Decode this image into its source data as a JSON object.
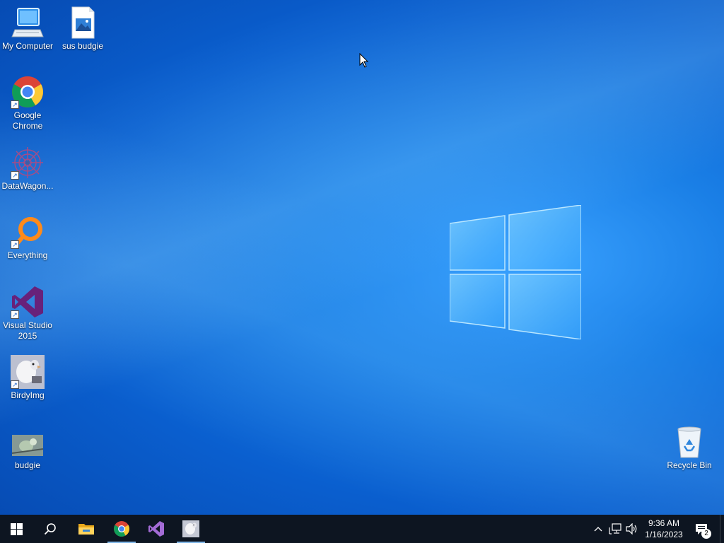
{
  "desktop": {
    "icons": [
      {
        "label": "My Computer",
        "icon": "computer-icon"
      },
      {
        "label": "sus budgie",
        "icon": "image-file-icon"
      },
      {
        "label": "Google Chrome",
        "icon": "chrome-icon"
      },
      {
        "label": "DataWagon...",
        "icon": "datawagon-icon"
      },
      {
        "label": "Everything",
        "icon": "everything-search-icon"
      },
      {
        "label": "Visual Studio 2015",
        "icon": "visual-studio-icon"
      },
      {
        "label": "BirdyImg",
        "icon": "bird-image-icon"
      },
      {
        "label": "budgie",
        "icon": "budgie-photo-icon"
      },
      {
        "label": "Recycle Bin",
        "icon": "recycle-bin-icon"
      }
    ]
  },
  "taskbar": {
    "buttons": [
      {
        "name": "start",
        "icon": "windows-start-icon"
      },
      {
        "name": "search",
        "icon": "search-icon"
      },
      {
        "name": "file-explorer",
        "icon": "folder-icon"
      },
      {
        "name": "chrome",
        "icon": "chrome-icon",
        "active": true
      },
      {
        "name": "visual-studio",
        "icon": "visual-studio-icon",
        "active": false
      },
      {
        "name": "birdyimg",
        "icon": "bird-image-icon",
        "active": true
      }
    ],
    "tray": {
      "time": "9:36 AM",
      "date": "1/16/2023",
      "notification_count": "2"
    }
  },
  "colors": {
    "wallpaper": "#0a5fcf",
    "taskbar": "#0d1521",
    "vs_purple": "#68217a"
  }
}
